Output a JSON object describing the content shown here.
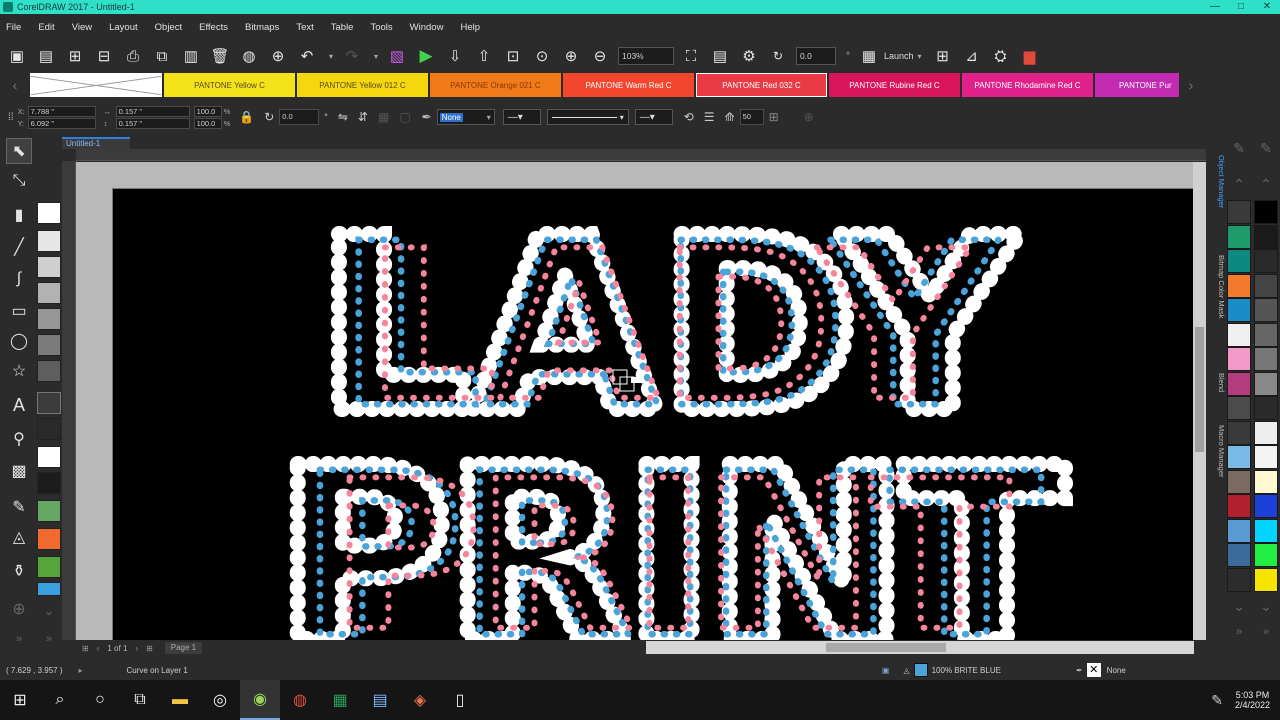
{
  "window": {
    "title": "CorelDRAW 2017 - Untitled-1",
    "minimize": "—",
    "restore": "□",
    "close": "✕"
  },
  "menu": [
    "File",
    "Edit",
    "View",
    "Layout",
    "Object",
    "Effects",
    "Bitmaps",
    "Text",
    "Table",
    "Tools",
    "Window",
    "Help"
  ],
  "toolbar": {
    "zoom_value": "103%",
    "rotation_value": "0.0",
    "launch_label": "Launch"
  },
  "pantone_swatches": [
    {
      "label": "",
      "color": "#ffffff"
    },
    {
      "label": "PANTONE Yellow C",
      "color": "#f3e21a"
    },
    {
      "label": "PANTONE Yellow 012 C",
      "color": "#f5d70f"
    },
    {
      "label": "PANTONE Orange 021 C",
      "color": "#f07b18"
    },
    {
      "label": "PANTONE Warm Red C",
      "color": "#f2472e"
    },
    {
      "label": "PANTONE Red 032 C",
      "color": "#ea3a45"
    },
    {
      "label": "PANTONE Rubine Red C",
      "color": "#d8155a"
    },
    {
      "label": "PANTONE Rhodamine Red C",
      "color": "#e0218a"
    },
    {
      "label": "PANTONE Pur",
      "color": "#c12ab1"
    }
  ],
  "propbar": {
    "x": "7.788 \"",
    "y": "6.092 \"",
    "w": "0.157 \"",
    "h": "0.157 \"",
    "scale_w": "100.0",
    "scale_h": "100.0",
    "pct": "%",
    "angle": "0.0",
    "outline_value": "None",
    "nodes": "50"
  },
  "document_tab": "Untitled-1",
  "page_nav": {
    "page_of": "1 of 1",
    "page_tab": "Page 1"
  },
  "docker_tabs": [
    "Object Manager",
    "Bitmap Color Mask",
    "Blend",
    "Macro Manager"
  ],
  "artwork": {
    "line1": "LADY",
    "line2": "PRINT",
    "colors": {
      "outline": "#ffffff",
      "mid": "#4aa3d9",
      "inner": "#f5859a"
    }
  },
  "status": {
    "coords": "( 7.629 , 3.957 )",
    "arrow": "▸",
    "object_info": "Curve on Layer 1",
    "fill_label": "100% BRITE BLUE",
    "fill_color": "#4aa3d9",
    "outline_label": "None"
  },
  "taskbar": {
    "time": "5:03 PM",
    "date": "2/4/2022"
  },
  "right_palette": [
    [
      "#3a3a3a",
      "#000000"
    ],
    [
      "#1f9b6b",
      "#1a1a1a"
    ],
    [
      "#0d8a80",
      "#2a2a2a"
    ],
    [
      "#f07b2d",
      "#444444"
    ],
    [
      "#1a8cc8",
      "#555555"
    ],
    [
      "#f0f0f0",
      "#666666"
    ],
    [
      "#f39acb",
      "#777777"
    ],
    [
      "#b23c7e",
      "#888888"
    ],
    [
      "#4b4b4b",
      "#2a2a2a"
    ],
    [
      "#3a3a3a",
      "#eeeeee"
    ],
    [
      "#7bb9e6",
      "#f4f4f4"
    ],
    [
      "#7b6a5f",
      "#fff8d0"
    ],
    [
      "#b21f2e",
      "#1e3fd8"
    ],
    [
      "#5b9bd5",
      "#00d4ff"
    ],
    [
      "#3a6b9a",
      "#22ee44"
    ],
    [
      "#2c2c2c",
      "#f5e400"
    ]
  ]
}
